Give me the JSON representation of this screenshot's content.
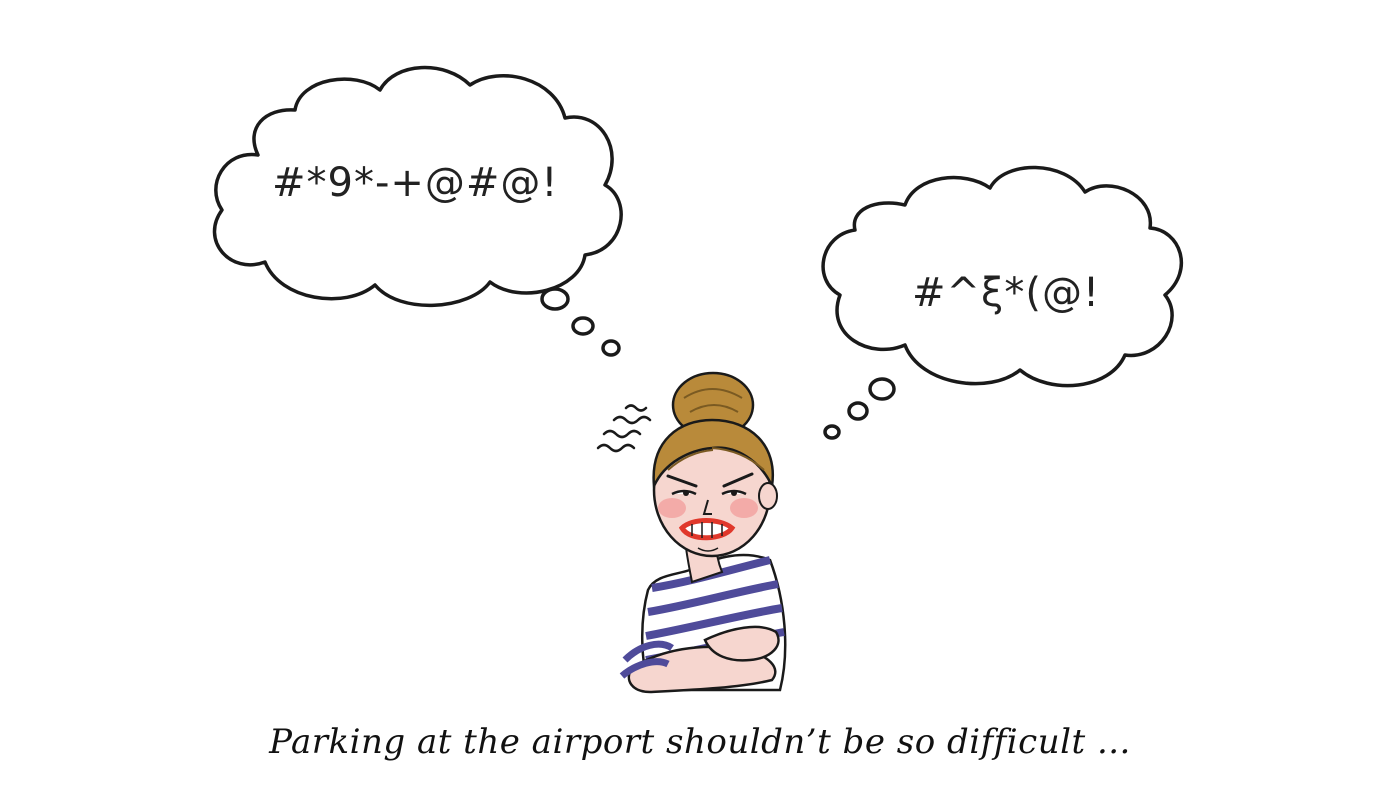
{
  "thought_bubbles": {
    "left": {
      "text": "#*9*-+@#@!"
    },
    "right": {
      "text": "#^ξ*(@!"
    }
  },
  "caption": {
    "text": "Parking at the airport shouldn’t be so difficult ..."
  },
  "colors": {
    "ink": "#1a1a1a",
    "hair": "#b98a3a",
    "skin": "#f6d6cf",
    "blush": "#f28e8e",
    "lips": "#e0382b",
    "stripes": "#4f4b9a"
  }
}
